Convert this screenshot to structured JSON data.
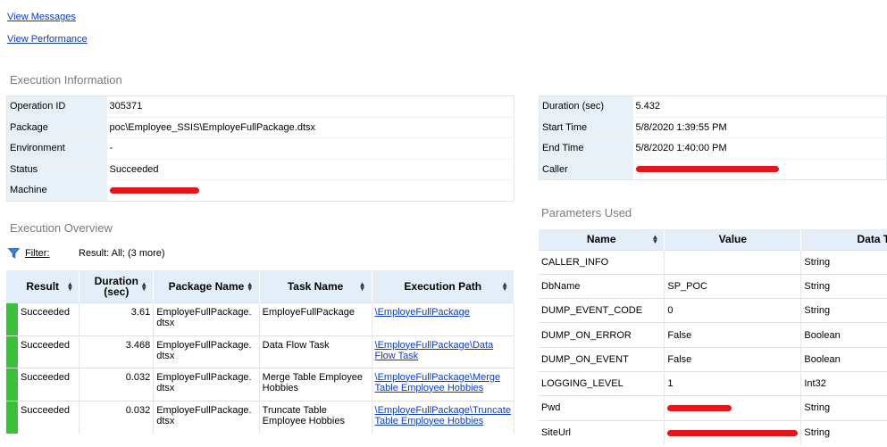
{
  "links": {
    "view_messages": "View Messages",
    "view_performance": "View Performance"
  },
  "execution_information": {
    "title": "Execution Information",
    "left_rows": [
      {
        "label": "Operation ID",
        "value": "305371",
        "redacted": false
      },
      {
        "label": "Package",
        "value": "poc\\Employee_SSIS\\EmployeFullPackage.dtsx",
        "redacted": false
      },
      {
        "label": "Environment",
        "value": "-",
        "redacted": false
      },
      {
        "label": "Status",
        "value": "Succeeded",
        "redacted": false
      },
      {
        "label": "Machine",
        "value": "",
        "redacted": true
      }
    ],
    "right_rows": [
      {
        "label": "Duration (sec)",
        "value": "5.432",
        "redacted": false
      },
      {
        "label": "Start Time",
        "value": "5/8/2020 1:39:55 PM",
        "redacted": false
      },
      {
        "label": "End Time",
        "value": "5/8/2020 1:40:00 PM",
        "redacted": false
      },
      {
        "label": "Caller",
        "value": "",
        "redacted": true
      }
    ]
  },
  "execution_overview": {
    "title": "Execution Overview",
    "filter_label": "Filter:",
    "filter_result": "Result: All;  (3 more)",
    "columns": [
      "Result",
      "Duration (sec)",
      "Package Name",
      "Task Name",
      "Execution Path"
    ],
    "rows": [
      {
        "result": "Succeeded",
        "duration": "3.61",
        "package": "EmployeFullPackage.dtsx",
        "task": "EmployeFullPackage",
        "path": "\\EmployeFullPackage"
      },
      {
        "result": "Succeeded",
        "duration": "3.468",
        "package": "EmployeFullPackage.dtsx",
        "task": "Data Flow Task",
        "path": "\\EmployeFullPackage\\Data Flow Task"
      },
      {
        "result": "Succeeded",
        "duration": "0.032",
        "package": "EmployeFullPackage.dtsx",
        "task": "Merge Table Employee Hobbies",
        "path": "\\EmployeFullPackage\\Merge Table Employee Hobbies"
      },
      {
        "result": "Succeeded",
        "duration": "0.032",
        "package": "EmployeFullPackage.dtsx",
        "task": "Truncate Table Employee Hobbies",
        "path": "\\EmployeFullPackage\\Truncate Table Employee Hobbies"
      }
    ]
  },
  "parameters_used": {
    "title": "Parameters Used",
    "columns": [
      "Name",
      "Value",
      "Data Ty"
    ],
    "rows": [
      {
        "name": "CALLER_INFO",
        "value": "",
        "type": "String",
        "redacted": false
      },
      {
        "name": "DbName",
        "value": "SP_POC",
        "type": "String",
        "redacted": false
      },
      {
        "name": "DUMP_EVENT_CODE",
        "value": "0",
        "type": "String",
        "redacted": false
      },
      {
        "name": "DUMP_ON_ERROR",
        "value": "False",
        "type": "Boolean",
        "redacted": false
      },
      {
        "name": "DUMP_ON_EVENT",
        "value": "False",
        "type": "Boolean",
        "redacted": false
      },
      {
        "name": "LOGGING_LEVEL",
        "value": "1",
        "type": "Int32",
        "redacted": false
      },
      {
        "name": "Pwd",
        "value": "",
        "type": "String",
        "redacted": true
      },
      {
        "name": "SiteUrl",
        "value": "",
        "type": "String",
        "redacted": true
      }
    ]
  },
  "colors": {
    "link": "#0b3bd6",
    "header_bg": "#e3eef8",
    "label_bg": "#e8f1f8",
    "success": "#3cc03c",
    "redaction": "#e8141b"
  },
  "icons": {
    "filter": "funnel-icon",
    "sort": "sort-updown-icon"
  }
}
